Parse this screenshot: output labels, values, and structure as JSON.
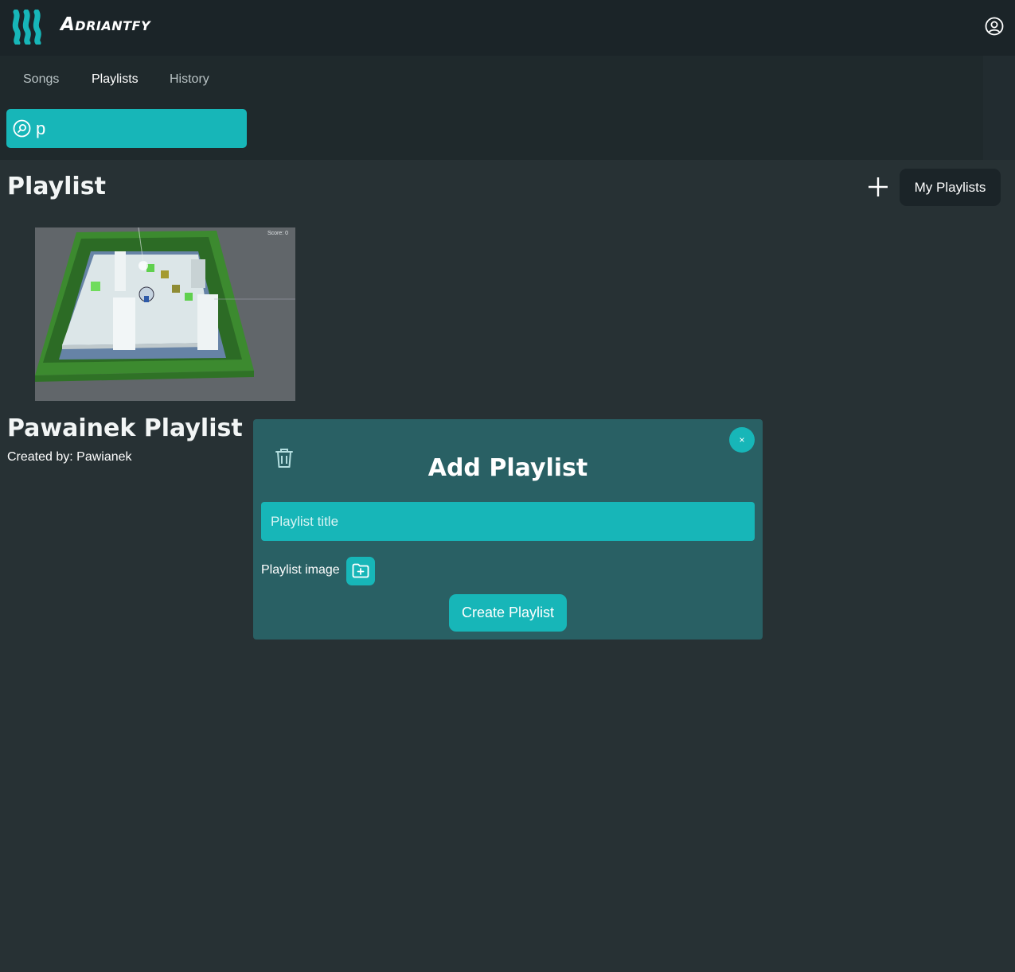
{
  "app": {
    "name": "Adriantfy",
    "logo_icon": "stripes-logo-icon",
    "user_icon": "user-circle-icon"
  },
  "nav": {
    "tabs": [
      {
        "label": "Songs",
        "active": false
      },
      {
        "label": "Playlists",
        "active": true
      },
      {
        "label": "History",
        "active": false
      }
    ]
  },
  "search": {
    "value": "p",
    "icon": "search-icon"
  },
  "main": {
    "title": "Playlist",
    "add_icon": "plus-icon",
    "my_playlists_label": "My Playlists"
  },
  "playlists": [
    {
      "title": "Pawainek Playlist",
      "author": "Created by: Pawianek",
      "image_overlay_text": "Score: 0"
    }
  ],
  "modal": {
    "title": "Add Playlist",
    "close_label": "×",
    "trash_icon": "trash-icon",
    "title_placeholder": "Playlist title",
    "title_value": "",
    "image_label": "Playlist image",
    "folder_icon": "folder-add-icon",
    "create_label": "Create Playlist"
  },
  "colors": {
    "accent": "#17b6b8",
    "topbar": "#1b2428",
    "background": "#273134",
    "modal": "#296064"
  }
}
